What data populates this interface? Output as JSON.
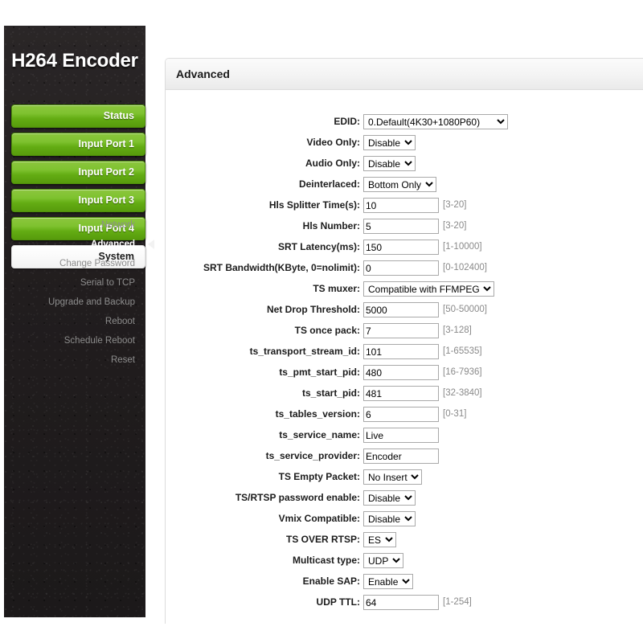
{
  "brand": {
    "title": "H264 Encoder"
  },
  "sidebar": {
    "main_items": [
      {
        "label": "Status",
        "active": false
      },
      {
        "label": "Input Port 1",
        "active": false
      },
      {
        "label": "Input Port 2",
        "active": false
      },
      {
        "label": "Input Port 3",
        "active": false
      },
      {
        "label": "Input Port 4",
        "active": false
      },
      {
        "label": "System",
        "active": true
      }
    ],
    "sub_items": [
      {
        "label": "Network",
        "active": false
      },
      {
        "label": "Advanced",
        "active": true
      },
      {
        "label": "Change Password",
        "active": false
      },
      {
        "label": "Serial to TCP",
        "active": false
      },
      {
        "label": "Upgrade and Backup",
        "active": false
      },
      {
        "label": "Reboot",
        "active": false
      },
      {
        "label": "Schedule Reboot",
        "active": false
      },
      {
        "label": "Reset",
        "active": false
      }
    ]
  },
  "panel": {
    "title": "Advanced",
    "fields": [
      {
        "name": "edid",
        "label": "EDID:",
        "type": "select",
        "value": "0.Default(4K30+1080P60)",
        "wide": true,
        "hint": ""
      },
      {
        "name": "video-only",
        "label": "Video Only:",
        "type": "select",
        "value": "Disable",
        "wide": false,
        "hint": ""
      },
      {
        "name": "audio-only",
        "label": "Audio Only:",
        "type": "select",
        "value": "Disable",
        "wide": false,
        "hint": ""
      },
      {
        "name": "deinterlaced",
        "label": "Deinterlaced:",
        "type": "select",
        "value": "Bottom Only",
        "wide": false,
        "hint": ""
      },
      {
        "name": "hls-splitter-time",
        "label": "Hls Splitter Time(s):",
        "type": "text",
        "value": "10",
        "wide": false,
        "hint": "[3-20]"
      },
      {
        "name": "hls-number",
        "label": "Hls Number:",
        "type": "text",
        "value": "5",
        "wide": false,
        "hint": "[3-20]"
      },
      {
        "name": "srt-latency",
        "label": "SRT Latency(ms):",
        "type": "text",
        "value": "150",
        "wide": false,
        "hint": "[1-10000]"
      },
      {
        "name": "srt-bandwidth",
        "label": "SRT Bandwidth(KByte, 0=nolimit):",
        "type": "text",
        "value": "0",
        "wide": false,
        "hint": "[0-102400]"
      },
      {
        "name": "ts-muxer",
        "label": "TS muxer:",
        "type": "select",
        "value": "Compatible with FFMPEG",
        "wide": false,
        "hint": ""
      },
      {
        "name": "net-drop-threshold",
        "label": "Net Drop Threshold:",
        "type": "text",
        "value": "5000",
        "wide": false,
        "hint": "[50-50000]"
      },
      {
        "name": "ts-once-pack",
        "label": "TS once pack:",
        "type": "text",
        "value": "7",
        "wide": false,
        "hint": "[3-128]"
      },
      {
        "name": "ts-transport-stream-id",
        "label": "ts_transport_stream_id:",
        "type": "text",
        "value": "101",
        "wide": false,
        "hint": "[1-65535]"
      },
      {
        "name": "ts-pmt-start-pid",
        "label": "ts_pmt_start_pid:",
        "type": "text",
        "value": "480",
        "wide": false,
        "hint": "[16-7936]"
      },
      {
        "name": "ts-start-pid",
        "label": "ts_start_pid:",
        "type": "text",
        "value": "481",
        "wide": false,
        "hint": "[32-3840]"
      },
      {
        "name": "ts-tables-version",
        "label": "ts_tables_version:",
        "type": "text",
        "value": "6",
        "wide": false,
        "hint": "[0-31]"
      },
      {
        "name": "ts-service-name",
        "label": "ts_service_name:",
        "type": "text",
        "value": "Live",
        "wide": false,
        "hint": ""
      },
      {
        "name": "ts-service-provider",
        "label": "ts_service_provider:",
        "type": "text",
        "value": "Encoder",
        "wide": false,
        "hint": ""
      },
      {
        "name": "ts-empty-packet",
        "label": "TS Empty Packet:",
        "type": "select",
        "value": "No Insert",
        "wide": false,
        "hint": ""
      },
      {
        "name": "ts-rtsp-password-enable",
        "label": "TS/RTSP password enable:",
        "type": "select",
        "value": "Disable",
        "wide": false,
        "hint": ""
      },
      {
        "name": "vmix-compatible",
        "label": "Vmix Compatible:",
        "type": "select",
        "value": "Disable",
        "wide": false,
        "hint": ""
      },
      {
        "name": "ts-over-rtsp",
        "label": "TS OVER RTSP:",
        "type": "select",
        "value": "ES",
        "wide": false,
        "hint": ""
      },
      {
        "name": "multicast-type",
        "label": "Multicast type:",
        "type": "select",
        "value": "UDP",
        "wide": false,
        "hint": ""
      },
      {
        "name": "enable-sap",
        "label": "Enable SAP:",
        "type": "select",
        "value": "Enable",
        "wide": false,
        "hint": ""
      },
      {
        "name": "udp-ttl",
        "label": "UDP TTL:",
        "type": "text",
        "value": "64",
        "wide": false,
        "hint": "[1-254]"
      }
    ]
  },
  "colors": {
    "accent_green": "#7ec22f",
    "sidebar_dark": "#231f20",
    "panel_header": "#f3f3f3"
  }
}
